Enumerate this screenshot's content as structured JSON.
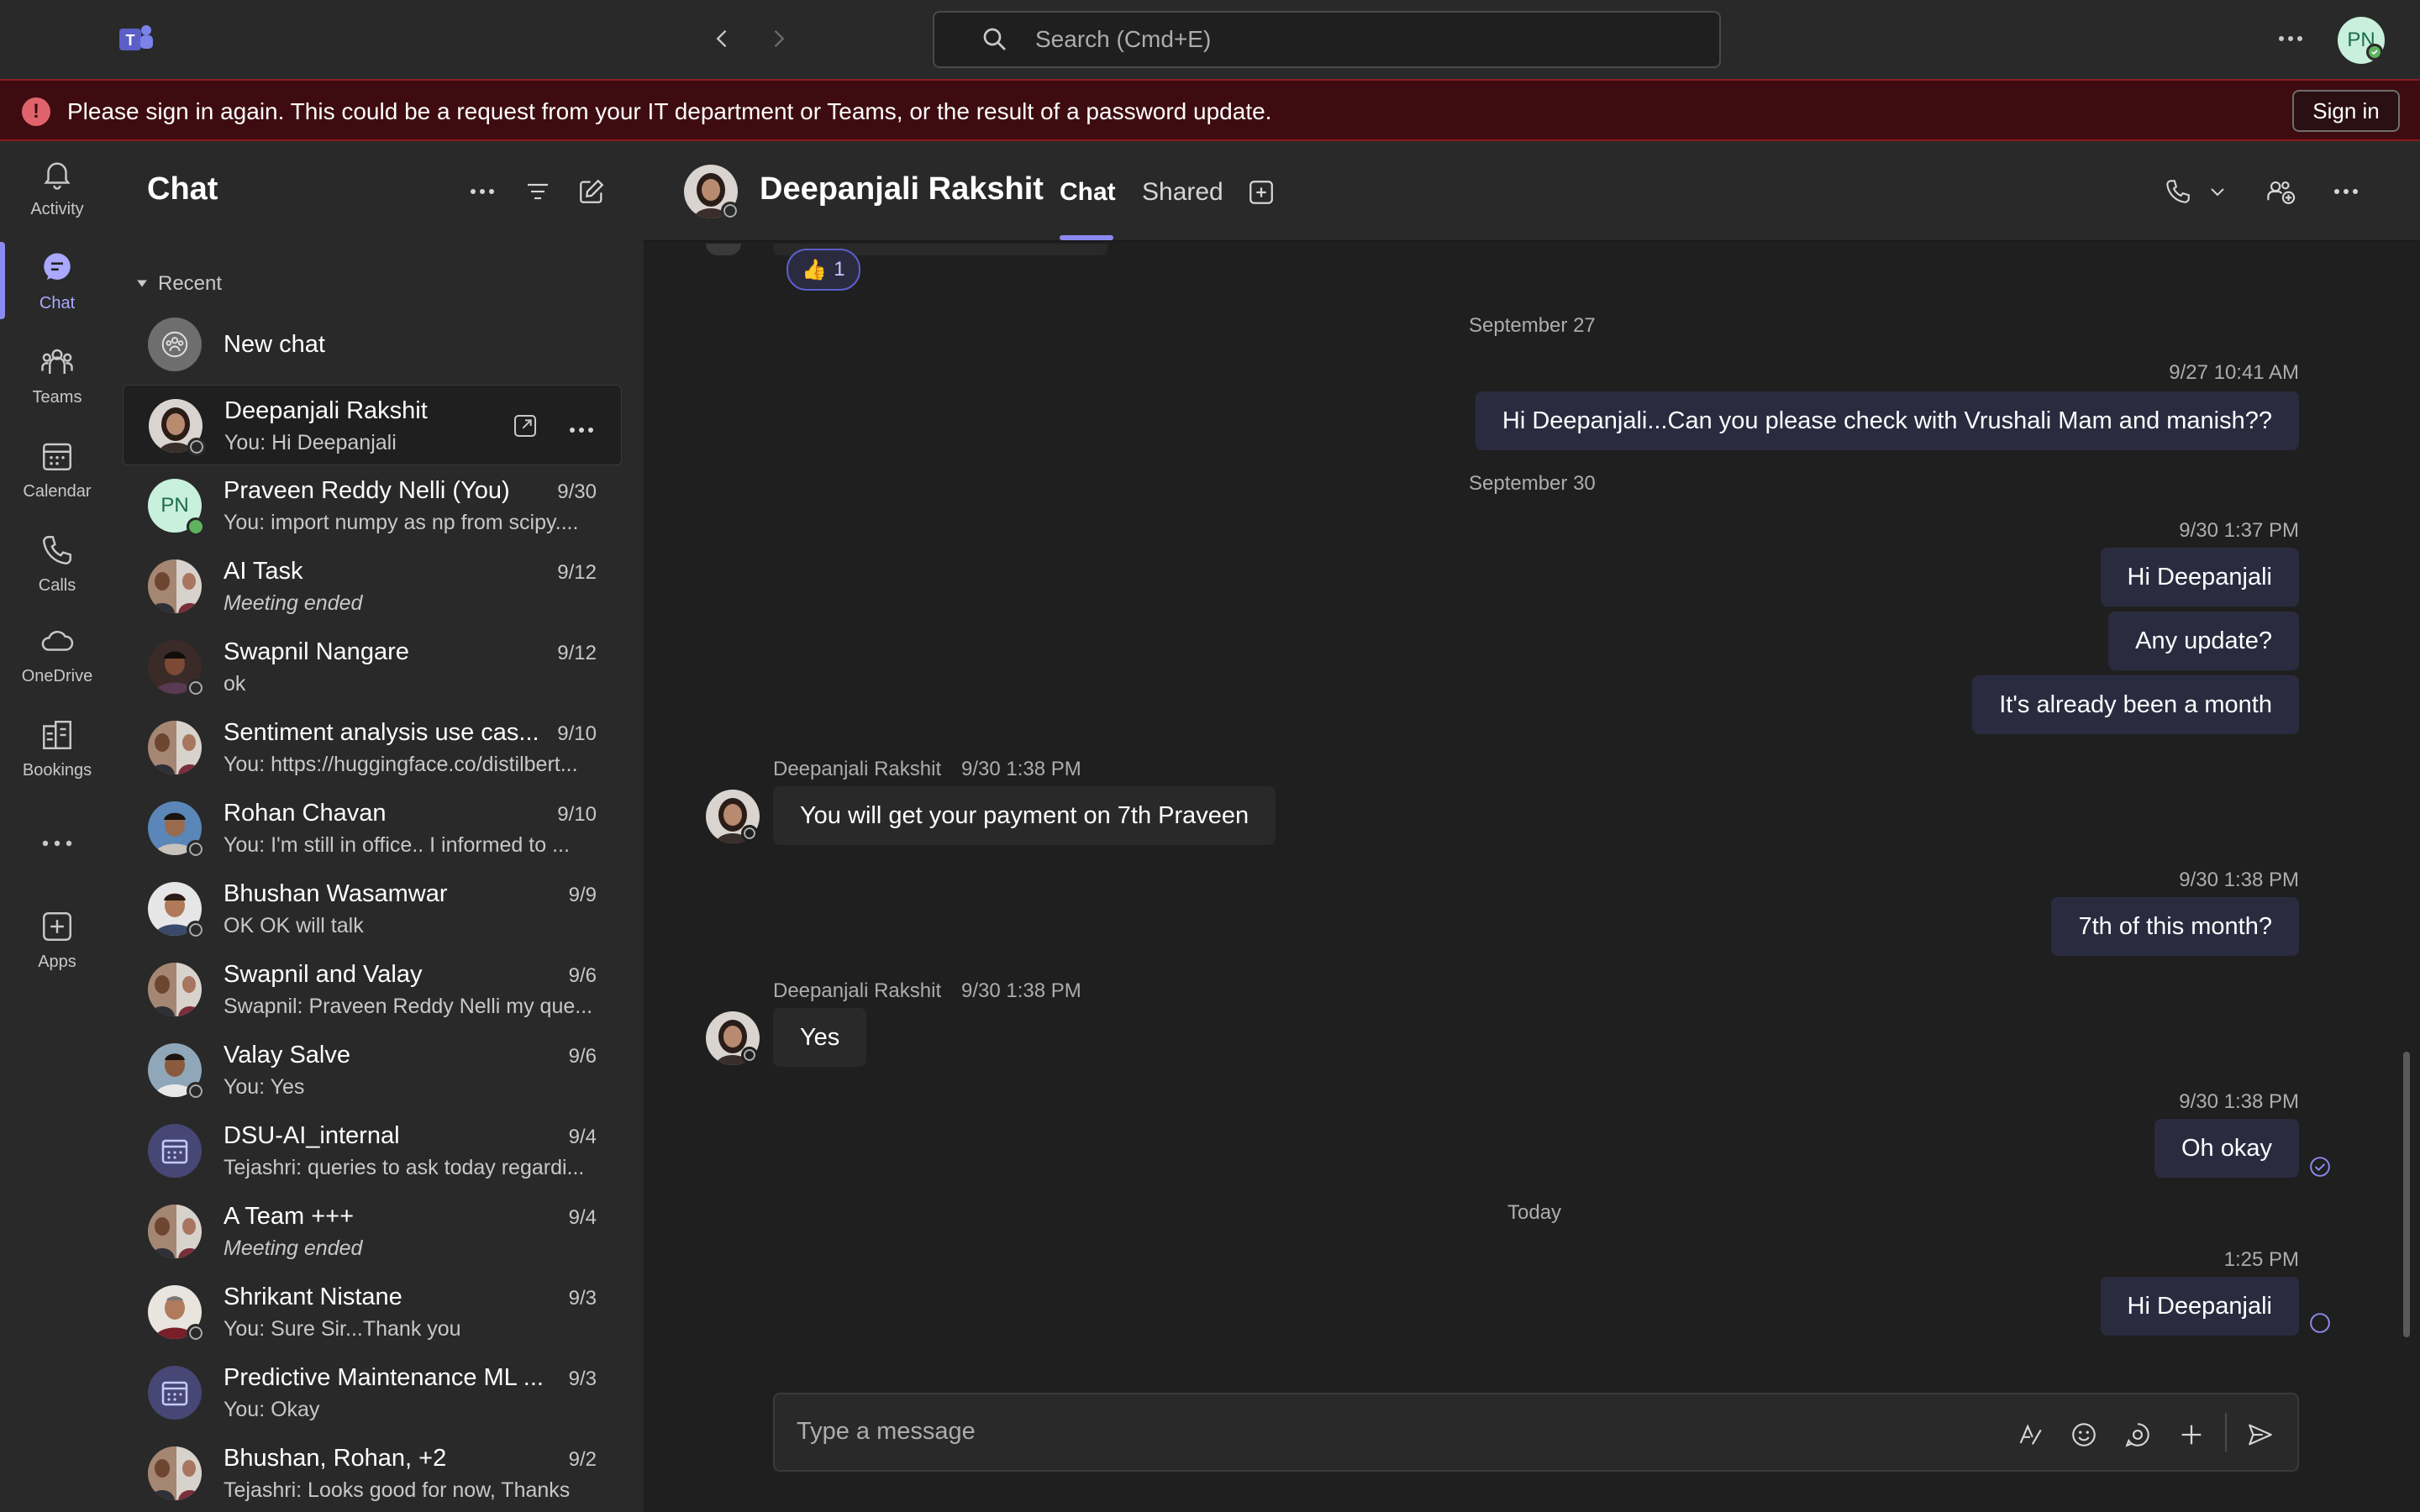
{
  "titlebar": {
    "search_placeholder": "Search (Cmd+E)",
    "profile_initials": "PN"
  },
  "banner": {
    "message": "Please sign in again. This could be a request from your IT department or Teams, or the result of a password update.",
    "signin_label": "Sign in"
  },
  "rail": {
    "items": [
      {
        "label": "Activity",
        "icon": "bell-icon"
      },
      {
        "label": "Chat",
        "icon": "chat-icon",
        "active": true
      },
      {
        "label": "Teams",
        "icon": "teams-icon"
      },
      {
        "label": "Calendar",
        "icon": "calendar-icon"
      },
      {
        "label": "Calls",
        "icon": "phone-icon"
      },
      {
        "label": "OneDrive",
        "icon": "cloud-icon"
      },
      {
        "label": "Bookings",
        "icon": "bookings-icon"
      },
      {
        "label": "Apps",
        "icon": "add-apps-icon"
      }
    ]
  },
  "chatlist": {
    "title": "Chat",
    "section_label": "Recent",
    "new_chat_label": "New chat",
    "chats": [
      {
        "name": "Deepanjali Rakshit",
        "date": "",
        "preview": "You: Hi Deepanjali",
        "selected": true
      },
      {
        "name": "Praveen Reddy Nelli (You)",
        "date": "9/30",
        "preview": "You: import numpy as np from scipy....",
        "initials": "PN"
      },
      {
        "name": "AI Task",
        "date": "9/12",
        "preview": "Meeting ended",
        "italic": true
      },
      {
        "name": "Swapnil Nangare",
        "date": "9/12",
        "preview": "ok"
      },
      {
        "name": "Sentiment analysis use cas...",
        "date": "9/10",
        "preview": "You: https://huggingface.co/distilbert..."
      },
      {
        "name": "Rohan Chavan",
        "date": "9/10",
        "preview": "You: I'm still in office.. I informed to ..."
      },
      {
        "name": "Bhushan Wasamwar",
        "date": "9/9",
        "preview": "OK OK will talk"
      },
      {
        "name": "Swapnil and Valay",
        "date": "9/6",
        "preview": "Swapnil: Praveen Reddy Nelli my que..."
      },
      {
        "name": "Valay Salve",
        "date": "9/6",
        "preview": "You: Yes"
      },
      {
        "name": "DSU-AI_internal",
        "date": "9/4",
        "preview": "Tejashri: queries to ask today regardi..."
      },
      {
        "name": "A Team +++",
        "date": "9/4",
        "preview": "Meeting ended",
        "italic": true
      },
      {
        "name": "Shrikant Nistane",
        "date": "9/3",
        "preview": "You: Sure Sir...Thank you"
      },
      {
        "name": "Predictive Maintenance ML ...",
        "date": "9/3",
        "preview": "You: Okay"
      },
      {
        "name": "Bhushan, Rohan, +2",
        "date": "9/2",
        "preview": "Tejashri: Looks good for now, Thanks"
      }
    ]
  },
  "conversation": {
    "name": "Deepanjali Rakshit",
    "tabs": [
      "Chat",
      "Shared"
    ],
    "reaction": {
      "emoji": "👍",
      "count": "1"
    },
    "sep1": "September 27",
    "m1_time": "9/27 10:41 AM",
    "m1_text": "Hi Deepanjali...Can you please check with Vrushali Mam and manish??",
    "sep2": "September 30",
    "m2_time": "9/30 1:37 PM",
    "m2_texts": [
      "Hi Deepanjali",
      "Any update?",
      "It's already been a month"
    ],
    "in1_sender": "Deepanjali Rakshit",
    "in1_time": "9/30 1:38 PM",
    "in1_text": "You will get your payment on 7th Praveen",
    "m3_time": "9/30 1:38 PM",
    "m3_text": "7th of this month?",
    "in2_sender": "Deepanjali Rakshit",
    "in2_time": "9/30 1:38 PM",
    "in2_text": "Yes",
    "m4_time": "9/30 1:38 PM",
    "m4_text": "Oh okay",
    "sep3": "Today",
    "m5_time": "1:25 PM",
    "m5_text": "Hi Deepanjali"
  },
  "compose": {
    "placeholder": "Type a message"
  },
  "colors": {
    "accent": "#8c8aef",
    "banner_bg": "#3e0c10",
    "outgoing_bubble": "#2b2b40",
    "incoming_bubble": "#292929",
    "presence_available": "#5fb35f"
  }
}
